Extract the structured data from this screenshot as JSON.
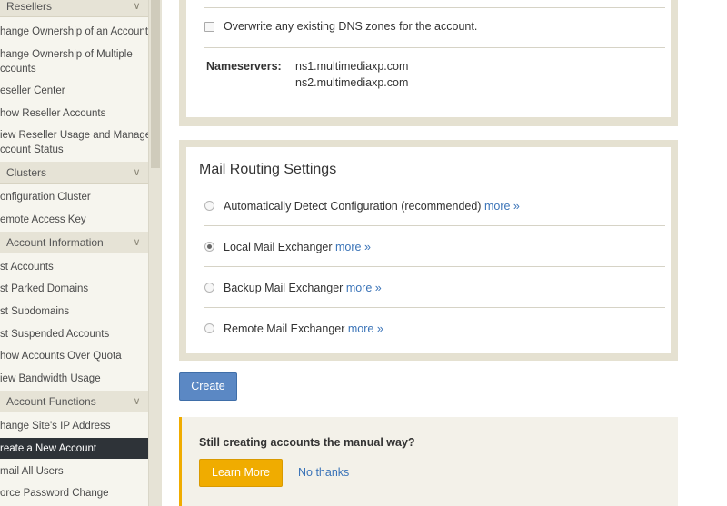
{
  "sidebar": {
    "resellers_header": "Resellers",
    "reseller_items": [
      "hange Ownership of an Account",
      "hange Ownership of Multiple",
      "ccounts",
      "eseller Center",
      "how Reseller Accounts",
      "iew Reseller Usage and Manage",
      "ccount Status"
    ],
    "clusters_header": "Clusters",
    "cluster_items": [
      "onfiguration Cluster",
      "emote Access Key"
    ],
    "account_info_header": "Account Information",
    "account_info_items": [
      "st Accounts",
      "st Parked Domains",
      "st Subdomains",
      "st Suspended Accounts",
      "how Accounts Over Quota",
      "iew Bandwidth Usage"
    ],
    "account_functions_header": "Account Functions",
    "account_function_items": [
      "hange Site's IP Address",
      "reate a New Account",
      "mail All Users",
      "orce Password Change"
    ],
    "chevron_glyph": "∨"
  },
  "dns": {
    "overwrite_label": "Overwrite any existing DNS zones for the account.",
    "overwrite_checked": false,
    "nameservers_label": "Nameservers:",
    "nameservers": [
      "ns1.multimediaxp.com",
      "ns2.multimediaxp.com"
    ]
  },
  "mail": {
    "title": "Mail Routing Settings",
    "more_link": "more »",
    "options": [
      {
        "label": "Automatically Detect Configuration (recommended)",
        "selected": false
      },
      {
        "label": "Local Mail Exchanger",
        "selected": true
      },
      {
        "label": "Backup Mail Exchanger",
        "selected": false
      },
      {
        "label": "Remote Mail Exchanger",
        "selected": false
      }
    ]
  },
  "create_button": "Create",
  "promo": {
    "question": "Still creating accounts the manual way?",
    "learn_more": "Learn More",
    "no_thanks": "No thanks"
  },
  "colors": {
    "accent": "#5b88c4",
    "link": "#3b74b8",
    "promo_accent": "#f0ac00",
    "sidebar_active": "#2e3338"
  }
}
